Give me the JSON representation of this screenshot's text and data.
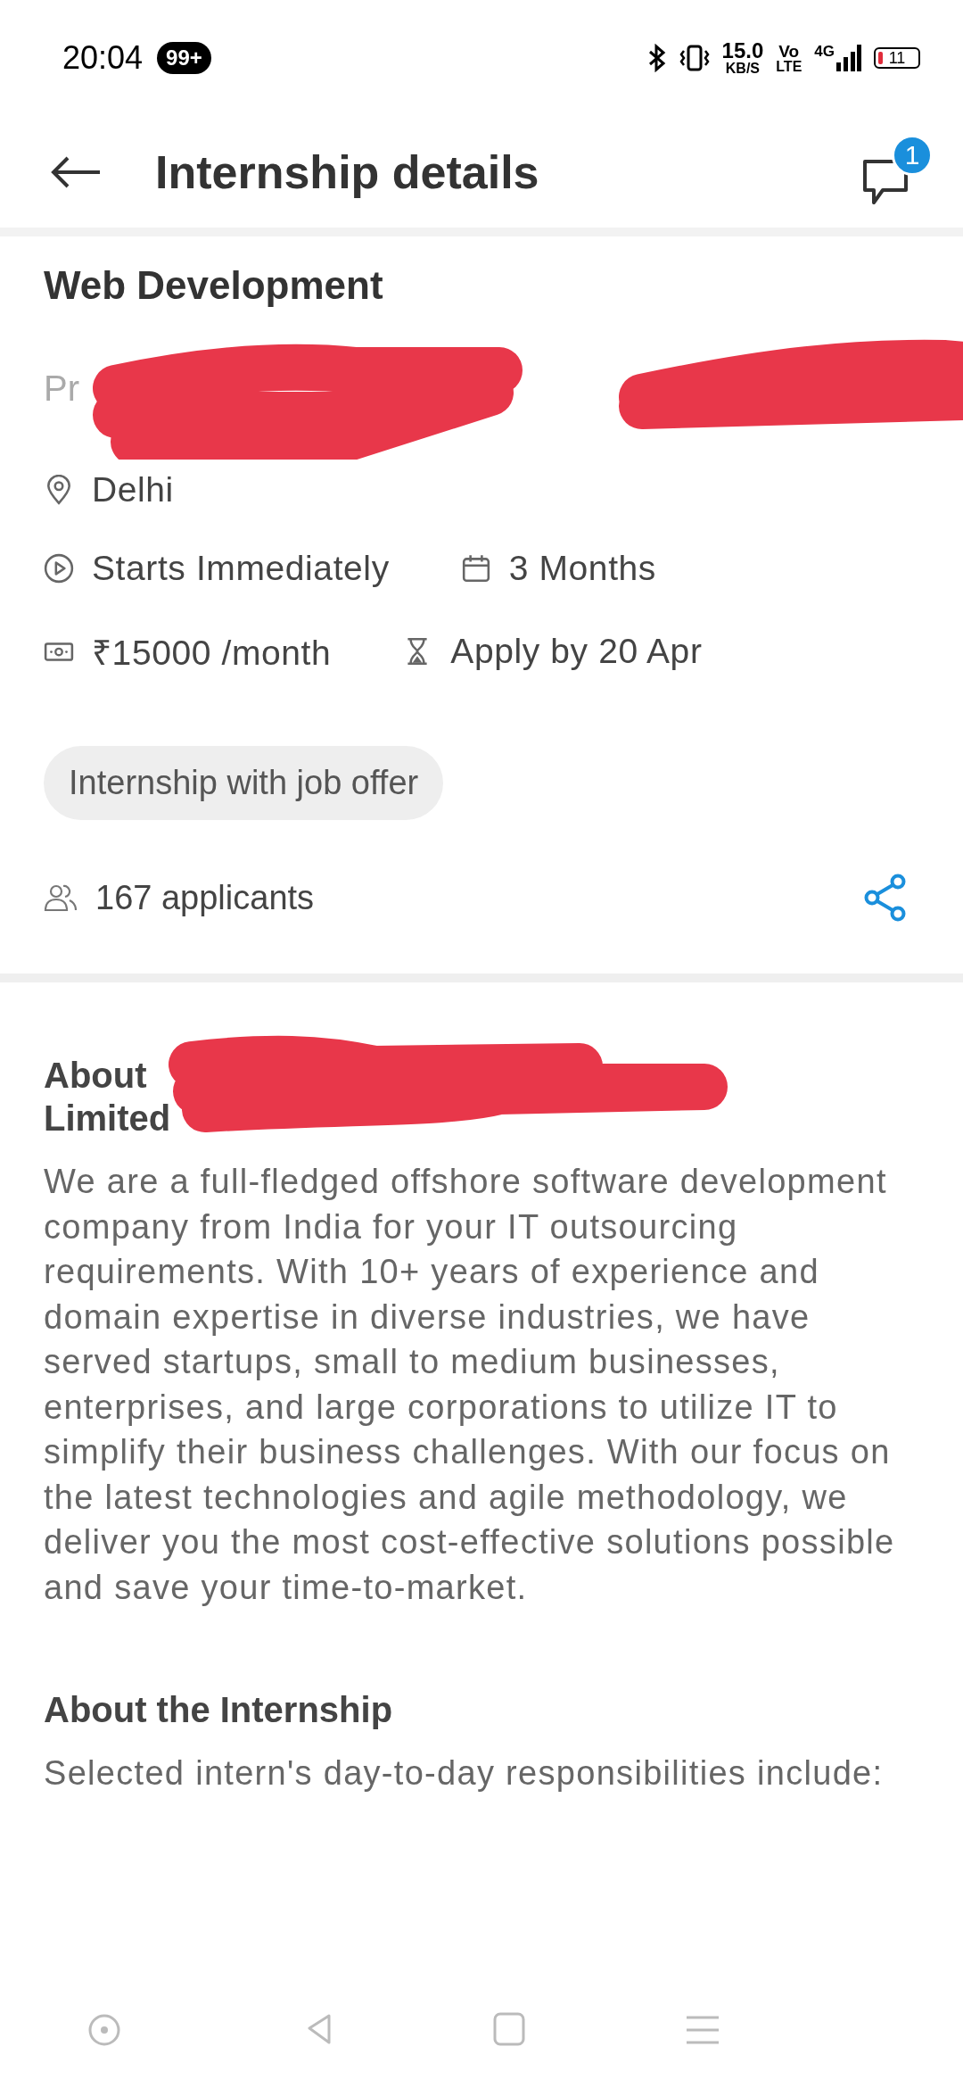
{
  "status_bar": {
    "time": "20:04",
    "notification_count": "99+",
    "net_speed": "15.0",
    "net_speed_unit": "KB/S",
    "volte_top": "Vo",
    "volte_bottom": "LTE",
    "network": "4G",
    "battery": "11"
  },
  "header": {
    "title": "Internship details",
    "chat_badge": "1"
  },
  "internship": {
    "title": "Web Development",
    "company": "Pr",
    "detail_rows": [
      [
        {
          "kind": "location",
          "text": "Delhi"
        }
      ],
      [
        {
          "kind": "start",
          "text": "Starts Immediately"
        },
        {
          "kind": "duration",
          "text": "3 Months"
        }
      ],
      [
        {
          "kind": "stipend",
          "text": "₹15000 /month"
        },
        {
          "kind": "deadline",
          "text": "Apply by 20 Apr"
        }
      ]
    ],
    "tag": "Internship with job offer",
    "applicants": "167 applicants"
  },
  "about_company": {
    "heading_start": "About",
    "heading_end": "Limited",
    "description": "We are a full-fledged offshore software development company from India for your IT outsourcing requirements. With 10+ years of experience and domain expertise in diverse industries, we have served startups, small to medium businesses, enterprises, and large corporations to utilize IT to simplify their business challenges. With our focus on the latest technologies and agile methodology, we deliver you the most cost-effective solutions possible and save your time-to-market."
  },
  "about_internship": {
    "heading": "About the Internship",
    "text": "Selected intern's day-to-day responsibilities include:"
  },
  "nav_bar": [
    {
      "kind": "assistant"
    },
    {
      "kind": "back"
    },
    {
      "kind": "home"
    },
    {
      "kind": "menu"
    }
  ]
}
